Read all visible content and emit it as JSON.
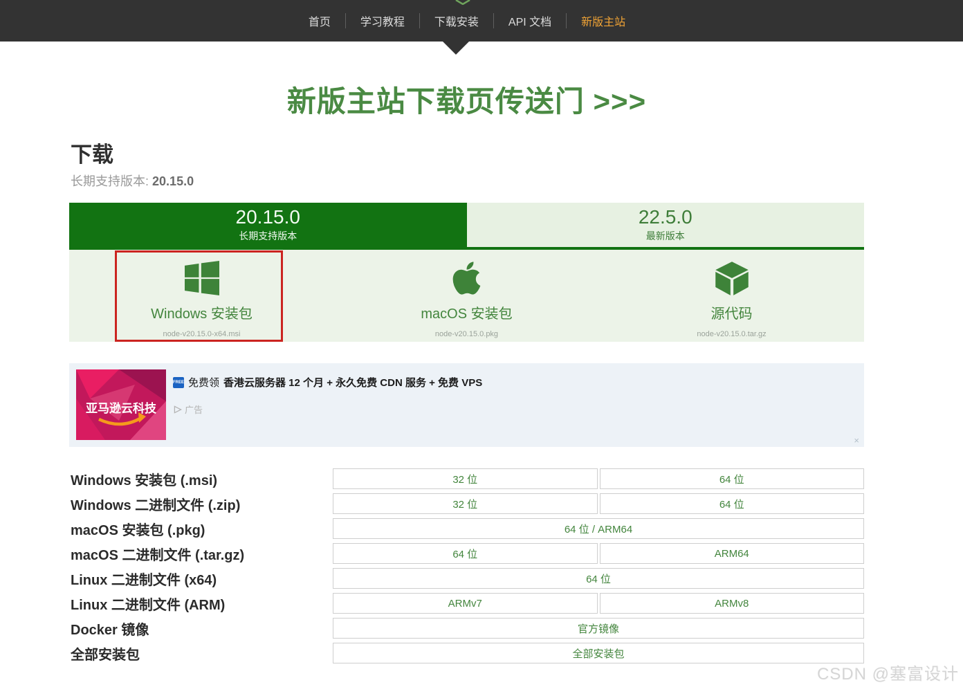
{
  "nav": {
    "items": [
      {
        "label": "首页"
      },
      {
        "label": "学习教程"
      },
      {
        "label": "下载安装"
      },
      {
        "label": "API 文档"
      },
      {
        "label": "新版主站"
      }
    ],
    "active_index": 4,
    "active_color": "#f0a335",
    "bar_color": "#333333"
  },
  "hero": {
    "title": "新版主站下载页传送门 >>>",
    "color": "#4a8a43"
  },
  "download": {
    "heading": "下载",
    "lts_label": "长期支持版本:",
    "lts_version": "20.15.0",
    "tabs": [
      {
        "version": "20.15.0",
        "caption": "长期支持版本",
        "active": true
      },
      {
        "version": "22.5.0",
        "caption": "最新版本",
        "active": false
      }
    ],
    "active_tab_color": "#127312",
    "options": [
      {
        "icon": "windows-logo-icon",
        "label": "Windows 安装包",
        "filename": "node-v20.15.0-x64.msi",
        "highlighted": true
      },
      {
        "icon": "apple-logo-icon",
        "label": "macOS 安装包",
        "filename": "node-v20.15.0.pkg",
        "highlighted": false
      },
      {
        "icon": "source-cube-icon",
        "label": "源代码",
        "filename": "node-v20.15.0.tar.gz",
        "highlighted": false
      }
    ],
    "highlight_border_color": "#cb2420"
  },
  "ad": {
    "image_text": "亚马逊云科技",
    "badge": "FREE",
    "headline_prefix": "免费领",
    "headline_bold": "香港云服务器 12 个月 + 永久免费 CDN 服务 + 免费 VPS",
    "ad_label": "广告",
    "close": "×",
    "background": "#edf2f7"
  },
  "table": {
    "rows": [
      {
        "label": "Windows 安装包 (.msi)",
        "buttons": [
          "32 位",
          "64 位"
        ]
      },
      {
        "label": "Windows 二进制文件 (.zip)",
        "buttons": [
          "32 位",
          "64 位"
        ]
      },
      {
        "label": "macOS 安装包 (.pkg)",
        "buttons": [
          "64 位 / ARM64"
        ]
      },
      {
        "label": "macOS 二进制文件 (.tar.gz)",
        "buttons": [
          "64 位",
          "ARM64"
        ]
      },
      {
        "label": "Linux 二进制文件 (x64)",
        "buttons": [
          "64 位"
        ]
      },
      {
        "label": "Linux 二进制文件 (ARM)",
        "buttons": [
          "ARMv7",
          "ARMv8"
        ]
      },
      {
        "label": "Docker 镜像",
        "buttons": [
          "官方镜像"
        ]
      },
      {
        "label": "全部安装包",
        "buttons": [
          "全部安装包"
        ]
      }
    ],
    "button_text_color": "#43853d"
  },
  "watermark": "CSDN @塞富设计"
}
